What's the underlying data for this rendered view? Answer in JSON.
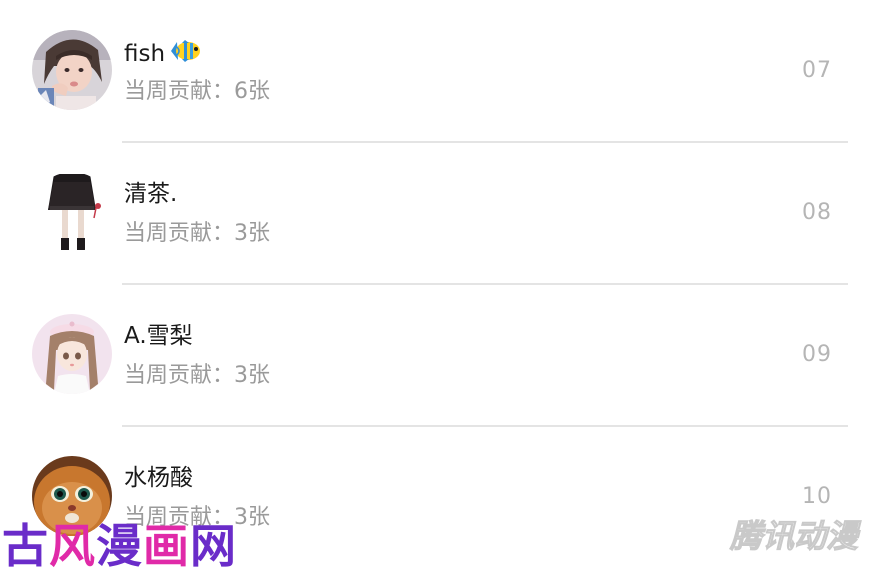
{
  "rows": [
    {
      "name": "fish",
      "name_icon": "tropical-fish-emoji-icon",
      "contribution": "当周贡献：6张",
      "rank": "07",
      "avatar": "avatar-girl-photo"
    },
    {
      "name": "清茶.",
      "contribution": "当周贡献：3张",
      "rank": "08",
      "avatar": "avatar-skirt-legs"
    },
    {
      "name": "A.雪梨",
      "contribution": "当周贡献：3张",
      "rank": "09",
      "avatar": "avatar-anime-girl-beret"
    },
    {
      "name": "水杨酸",
      "contribution": "当周贡献：3张",
      "rank": "10",
      "avatar": "avatar-cat-face"
    }
  ],
  "watermarks": {
    "left": "古风漫画网",
    "right": "腾讯动漫"
  },
  "colors": {
    "name_text": "#1a1a1a",
    "secondary_text": "#9a9a9a",
    "rank_text": "#b5b5b5",
    "divider": "#e4e4e4",
    "watermark_left_1": "#6a2cc9",
    "watermark_left_2": "#e02aa8"
  }
}
